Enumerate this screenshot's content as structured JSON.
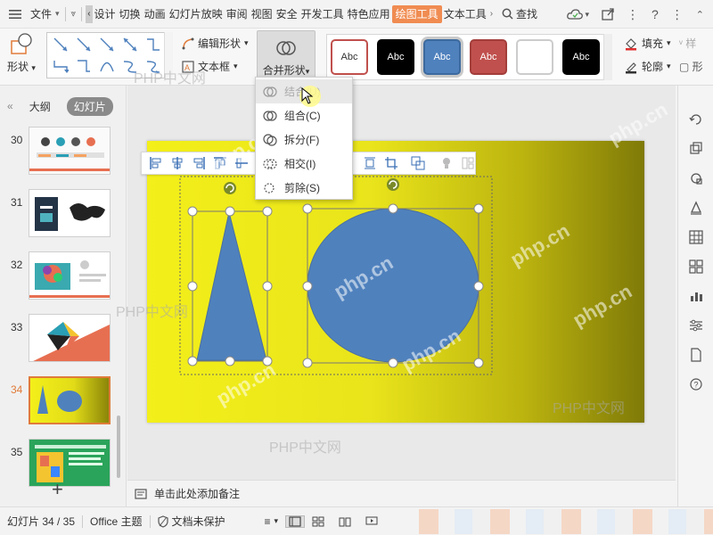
{
  "menubar": {
    "file_label": "文件",
    "tabs": [
      "设计",
      "切换",
      "动画",
      "幻灯片放映",
      "审阅",
      "视图",
      "安全",
      "开发工具",
      "特色应用",
      "绘图工具",
      "文本工具"
    ],
    "active_tab": "绘图工具",
    "search_label": "查找"
  },
  "ribbon": {
    "shape_label": "形状",
    "edit_shape_label": "编辑形状",
    "textbox_label": "文本框",
    "merge_shapes_label": "合并形状",
    "fill_label": "填充",
    "outline_label": "轮廓",
    "style_swatches": [
      {
        "text": "Abc",
        "bg": "#ffffff",
        "fg": "#333333",
        "border": "#c0504d"
      },
      {
        "text": "Abc",
        "bg": "#000000",
        "fg": "#ffffff",
        "border": "#000000"
      },
      {
        "text": "Abc",
        "bg": "#4f81bd",
        "fg": "#ffffff",
        "border": "#3c6a9e"
      },
      {
        "text": "Abc",
        "bg": "#c0504d",
        "fg": "#ffffff",
        "border": "#a33e3b"
      },
      {
        "text": "",
        "bg": "#ffffff",
        "fg": "#333333",
        "border": "#cccccc"
      },
      {
        "text": "Abc",
        "bg": "#000000",
        "fg": "#ffffff",
        "border": "#000000"
      }
    ]
  },
  "left_panel": {
    "tab_outline": "大纲",
    "tab_slides": "幻灯片",
    "slides": [
      {
        "num": "30"
      },
      {
        "num": "31"
      },
      {
        "num": "32"
      },
      {
        "num": "33"
      },
      {
        "num": "34"
      },
      {
        "num": "35"
      }
    ],
    "selected_slide": "34"
  },
  "merge_menu": {
    "items": [
      {
        "label": "结合(U)",
        "icon": "union-icon"
      },
      {
        "label": "组合(C)",
        "icon": "combine-icon"
      },
      {
        "label": "拆分(F)",
        "icon": "fragment-icon"
      },
      {
        "label": "相交(I)",
        "icon": "intersect-icon"
      },
      {
        "label": "剪除(S)",
        "icon": "subtract-icon"
      }
    ],
    "hovered": "结合(U)"
  },
  "slide": {
    "triangle_color": "#4f81bd",
    "circle_color": "#4f81bd",
    "background_start": "#f3ef1a",
    "background_end": "#7f7a08"
  },
  "notes": {
    "placeholder": "单击此处添加备注"
  },
  "statusbar": {
    "slide_position": "幻灯片 34 / 35",
    "theme": "Office 主题",
    "protection": "文档未保护"
  },
  "watermarks": {
    "text_a": "php.cn",
    "text_b": "PHP中文网"
  },
  "colors": {
    "accent": "#f08c52",
    "selection_orange": "#e07b3a"
  }
}
